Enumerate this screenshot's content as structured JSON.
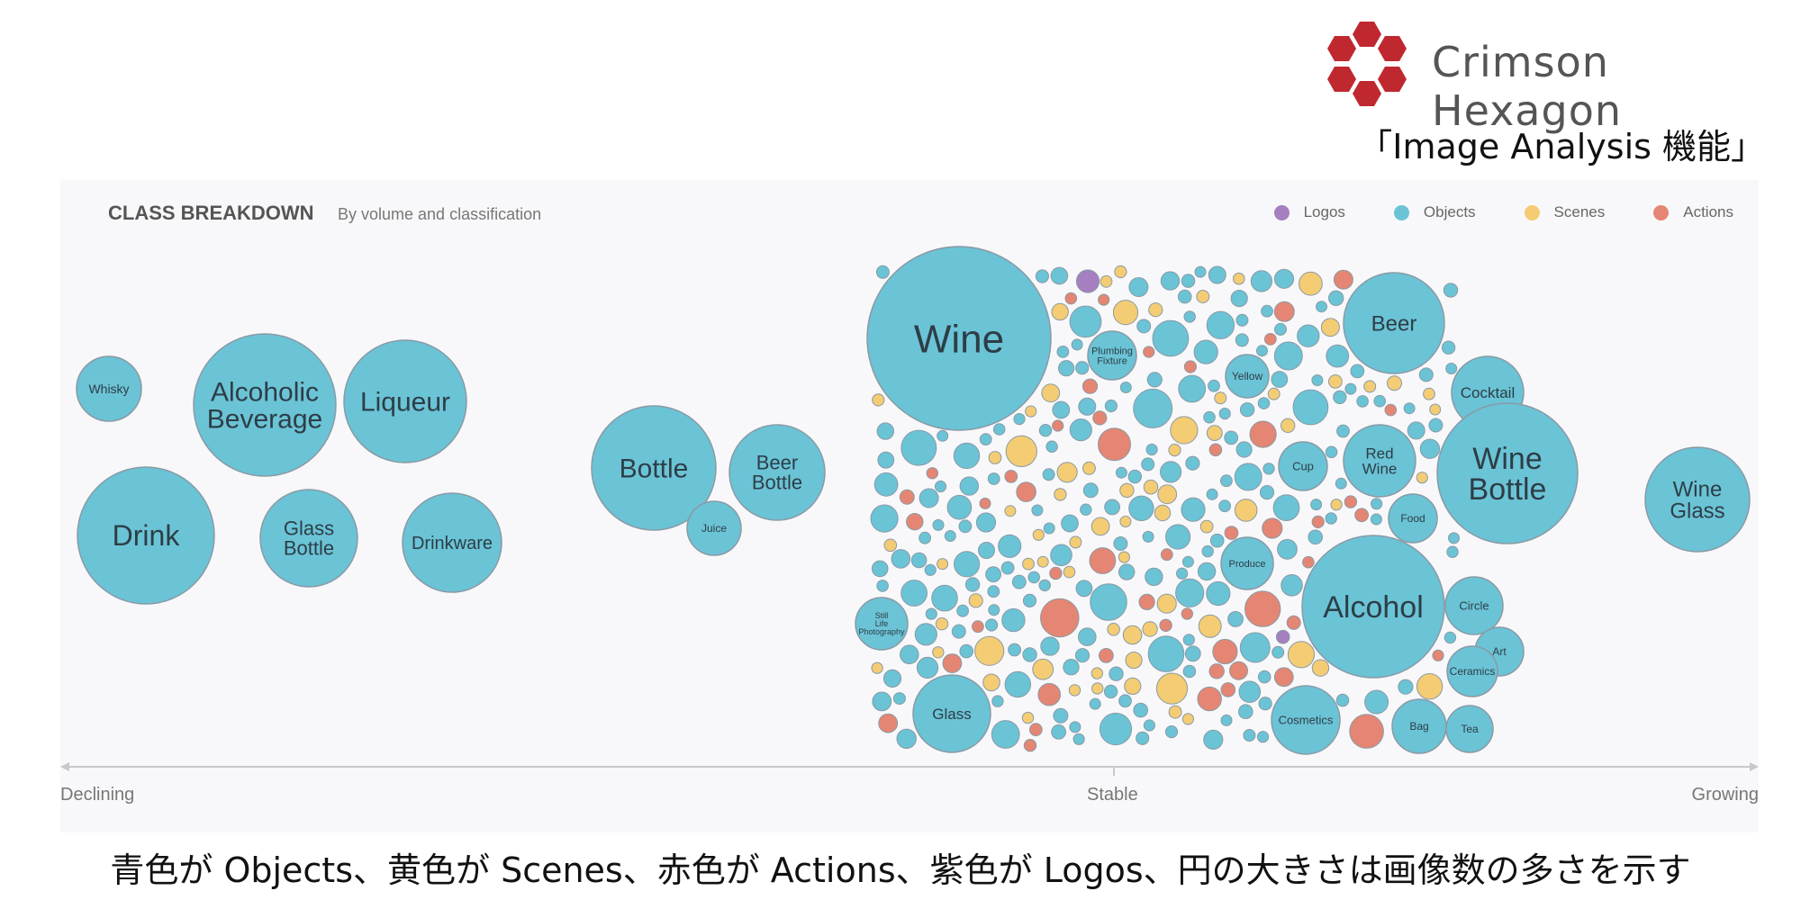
{
  "brand": {
    "name": "Crimson Hexagon",
    "color": "#c0282f"
  },
  "subtitle": "「Image Analysis 機能」",
  "caption": "青色が Objects、黄色が Scenes、赤色が Actions、紫色が Logos、円の大きさは画像数の多さを示す",
  "chart_data": {
    "type": "bubble",
    "title": "CLASS BREAKDOWN",
    "subtitle": "By volume and classification",
    "legend": [
      {
        "name": "Logos",
        "color": "#a57fbf"
      },
      {
        "name": "Objects",
        "color": "#6bc3d6"
      },
      {
        "name": "Scenes",
        "color": "#f4cc74"
      },
      {
        "name": "Actions",
        "color": "#e48673"
      }
    ],
    "x_axis": {
      "left": "Declining",
      "center": "Stable",
      "right": "Growing"
    },
    "legend_position": "top-right",
    "labeled_bubbles": [
      {
        "label": "Whisky",
        "class": "Objects"
      },
      {
        "label": "Alcoholic\nBeverage",
        "class": "Objects"
      },
      {
        "label": "Liqueur",
        "class": "Objects"
      },
      {
        "label": "Drink",
        "class": "Objects"
      },
      {
        "label": "Glass\nBottle",
        "class": "Objects"
      },
      {
        "label": "Drinkware",
        "class": "Objects"
      },
      {
        "label": "Bottle",
        "class": "Objects"
      },
      {
        "label": "Beer\nBottle",
        "class": "Objects"
      },
      {
        "label": "Juice",
        "class": "Objects"
      },
      {
        "label": "Wine",
        "class": "Objects"
      },
      {
        "label": "Plumbing\nFixture",
        "class": "Objects"
      },
      {
        "label": "Yellow",
        "class": "Objects"
      },
      {
        "label": "Beer",
        "class": "Objects"
      },
      {
        "label": "Cocktail",
        "class": "Objects"
      },
      {
        "label": "Cup",
        "class": "Objects"
      },
      {
        "label": "Red\nWine",
        "class": "Objects"
      },
      {
        "label": "Wine\nBottle",
        "class": "Objects"
      },
      {
        "label": "Wine\nGlass",
        "class": "Objects"
      },
      {
        "label": "Food",
        "class": "Objects"
      },
      {
        "label": "Produce",
        "class": "Objects"
      },
      {
        "label": "Alcohol",
        "class": "Objects"
      },
      {
        "label": "Circle",
        "class": "Objects"
      },
      {
        "label": "Still\nLife\nPhotography",
        "class": "Objects"
      },
      {
        "label": "Art",
        "class": "Objects"
      },
      {
        "label": "Ceramics",
        "class": "Objects"
      },
      {
        "label": "Glass",
        "class": "Objects"
      },
      {
        "label": "Cosmetics",
        "class": "Objects"
      },
      {
        "label": "Bag",
        "class": "Objects"
      },
      {
        "label": "Tea",
        "class": "Objects"
      }
    ]
  }
}
